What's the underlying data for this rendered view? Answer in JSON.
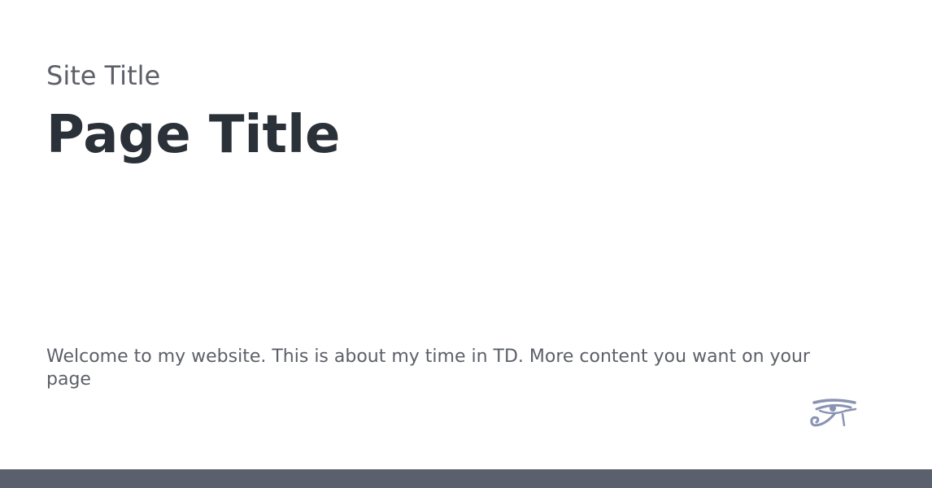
{
  "header": {
    "site_title": "Site Title",
    "page_title": "Page Title"
  },
  "main": {
    "welcome_text": "Welcome to my website. This is about my time in TD. More content you want on your page"
  },
  "logo": {
    "icon": "eye-of-horus-icon",
    "color": "#8a93b2"
  },
  "colors": {
    "footer": "#5b616c",
    "heading": "#2b3139",
    "muted_text": "#5d6068"
  }
}
